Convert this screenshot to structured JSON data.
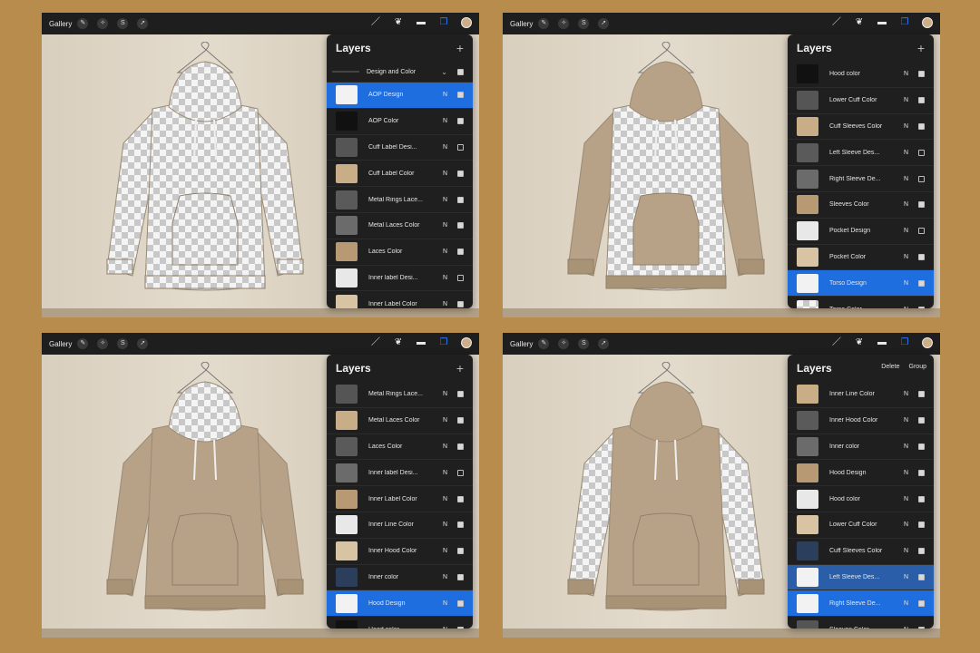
{
  "screens": [
    {
      "panel": {
        "title": "Layers",
        "group": {
          "name": "Design and Color"
        },
        "layers": [
          {
            "name": "AOP  Design",
            "mode": "N",
            "checked": true,
            "selected": true
          },
          {
            "name": "AOP Color",
            "mode": "N",
            "checked": true
          },
          {
            "name": "Cuff Label Desi...",
            "mode": "N",
            "checked": false
          },
          {
            "name": "Cuff  Label Color",
            "mode": "N",
            "checked": true
          },
          {
            "name": "Metal Rings Lace...",
            "mode": "N",
            "checked": true
          },
          {
            "name": "Metal Laces Color",
            "mode": "N",
            "checked": true
          },
          {
            "name": "Laces Color",
            "mode": "N",
            "checked": true
          },
          {
            "name": "Inner label Desi...",
            "mode": "N",
            "checked": false
          },
          {
            "name": "Inner Label Color",
            "mode": "N",
            "checked": true
          }
        ]
      }
    },
    {
      "panel": {
        "title": "Layers",
        "layers": [
          {
            "name": "Hood color",
            "mode": "N",
            "checked": true
          },
          {
            "name": "Lower Cuff Color",
            "mode": "N",
            "checked": true
          },
          {
            "name": "Cuff Sleeves Color",
            "mode": "N",
            "checked": true
          },
          {
            "name": "Left Sleeve Des...",
            "mode": "N",
            "checked": false
          },
          {
            "name": "Right Sleeve De...",
            "mode": "N",
            "checked": false
          },
          {
            "name": "Sleeves Color",
            "mode": "N",
            "checked": true
          },
          {
            "name": "Pocket Design",
            "mode": "N",
            "checked": false
          },
          {
            "name": "Pocket Color",
            "mode": "N",
            "checked": true
          },
          {
            "name": "Torso Design",
            "mode": "N",
            "checked": true,
            "selected": true
          },
          {
            "name": "Torso Color",
            "mode": "N",
            "checked": true
          }
        ]
      }
    },
    {
      "panel": {
        "title": "Layers",
        "layers": [
          {
            "name": "Metal Rings Lace...",
            "mode": "N",
            "checked": true
          },
          {
            "name": "Metal Laces Color",
            "mode": "N",
            "checked": true
          },
          {
            "name": "Laces Color",
            "mode": "N",
            "checked": true
          },
          {
            "name": "Inner label Desi...",
            "mode": "N",
            "checked": false
          },
          {
            "name": "Inner Label Color",
            "mode": "N",
            "checked": true
          },
          {
            "name": "Inner Line Color",
            "mode": "N",
            "checked": true
          },
          {
            "name": "Inner Hood Color",
            "mode": "N",
            "checked": true
          },
          {
            "name": "Inner color",
            "mode": "N",
            "checked": true
          },
          {
            "name": "Hood Design",
            "mode": "N",
            "checked": true,
            "selected": true
          },
          {
            "name": "Hood color",
            "mode": "N",
            "checked": true
          }
        ]
      }
    },
    {
      "panel": {
        "title": "Layers",
        "actions": {
          "delete": "Delete",
          "group": "Group"
        },
        "layers": [
          {
            "name": "Inner Line Color",
            "mode": "N",
            "checked": true
          },
          {
            "name": "Inner Hood Color",
            "mode": "N",
            "checked": true
          },
          {
            "name": "Inner color",
            "mode": "N",
            "checked": true
          },
          {
            "name": "Hood Design",
            "mode": "N",
            "checked": true
          },
          {
            "name": "Hood color",
            "mode": "N",
            "checked": true
          },
          {
            "name": "Lower Cuff Color",
            "mode": "N",
            "checked": true
          },
          {
            "name": "Cuff Sleeves Color",
            "mode": "N",
            "checked": true
          },
          {
            "name": "Left Sleeve Des...",
            "mode": "N",
            "checked": true,
            "selected_secondary": true
          },
          {
            "name": "Right Sleeve De...",
            "mode": "N",
            "checked": true,
            "selected": true
          },
          {
            "name": "Sleeves Color",
            "mode": "N",
            "checked": true
          }
        ]
      }
    }
  ],
  "topbar": {
    "gallery_label": "Gallery",
    "left_icons": [
      "wrench-icon",
      "magic-wand-icon",
      "selection-icon",
      "move-arrow-icon"
    ],
    "right_icons": [
      "brush-icon",
      "smudge-icon",
      "eraser-icon",
      "layers-icon"
    ],
    "color_swatch": "#cfae86"
  },
  "colors": {
    "hoodie_tan": "#b7a287",
    "accent_blue": "#1f6ee0",
    "panel_bg": "#1f1f1f",
    "frame_bg": "#b78c4c"
  }
}
